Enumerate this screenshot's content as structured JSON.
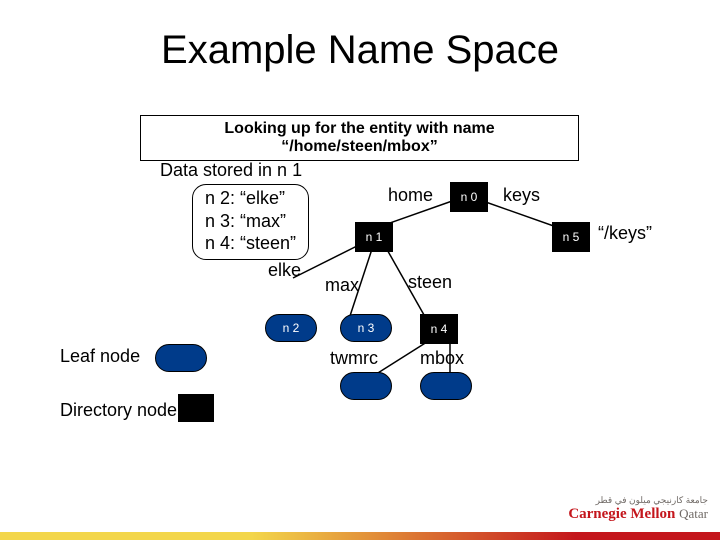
{
  "title": "Example Name Space",
  "lookup_text": "Looking up for the entity with name “/home/steen/mbox”",
  "stored_label": "Data stored in n 1",
  "data_box_lines": {
    "l1": "n 2: “elke”",
    "l2": "n 3: “max”",
    "l3": "n 4: “steen”"
  },
  "nodes": {
    "n0": "n 0",
    "n1": "n 1",
    "n5": "n 5",
    "n2": "n 2",
    "n3": "n 3",
    "n4": "n 4"
  },
  "edges": {
    "home": "home",
    "keys": "keys",
    "keys_q": "“/keys”",
    "elke": "elke",
    "max": "max",
    "steen": "steen",
    "twmrc": "twmrc",
    "mbox": "mbox"
  },
  "legend": {
    "leaf": "Leaf node",
    "dir": "Directory node"
  },
  "logo": {
    "ar": "جامعة كارنيجي ميلون في قطر",
    "en_main": "Carnegie Mellon",
    "en_sub": "Qatar"
  }
}
